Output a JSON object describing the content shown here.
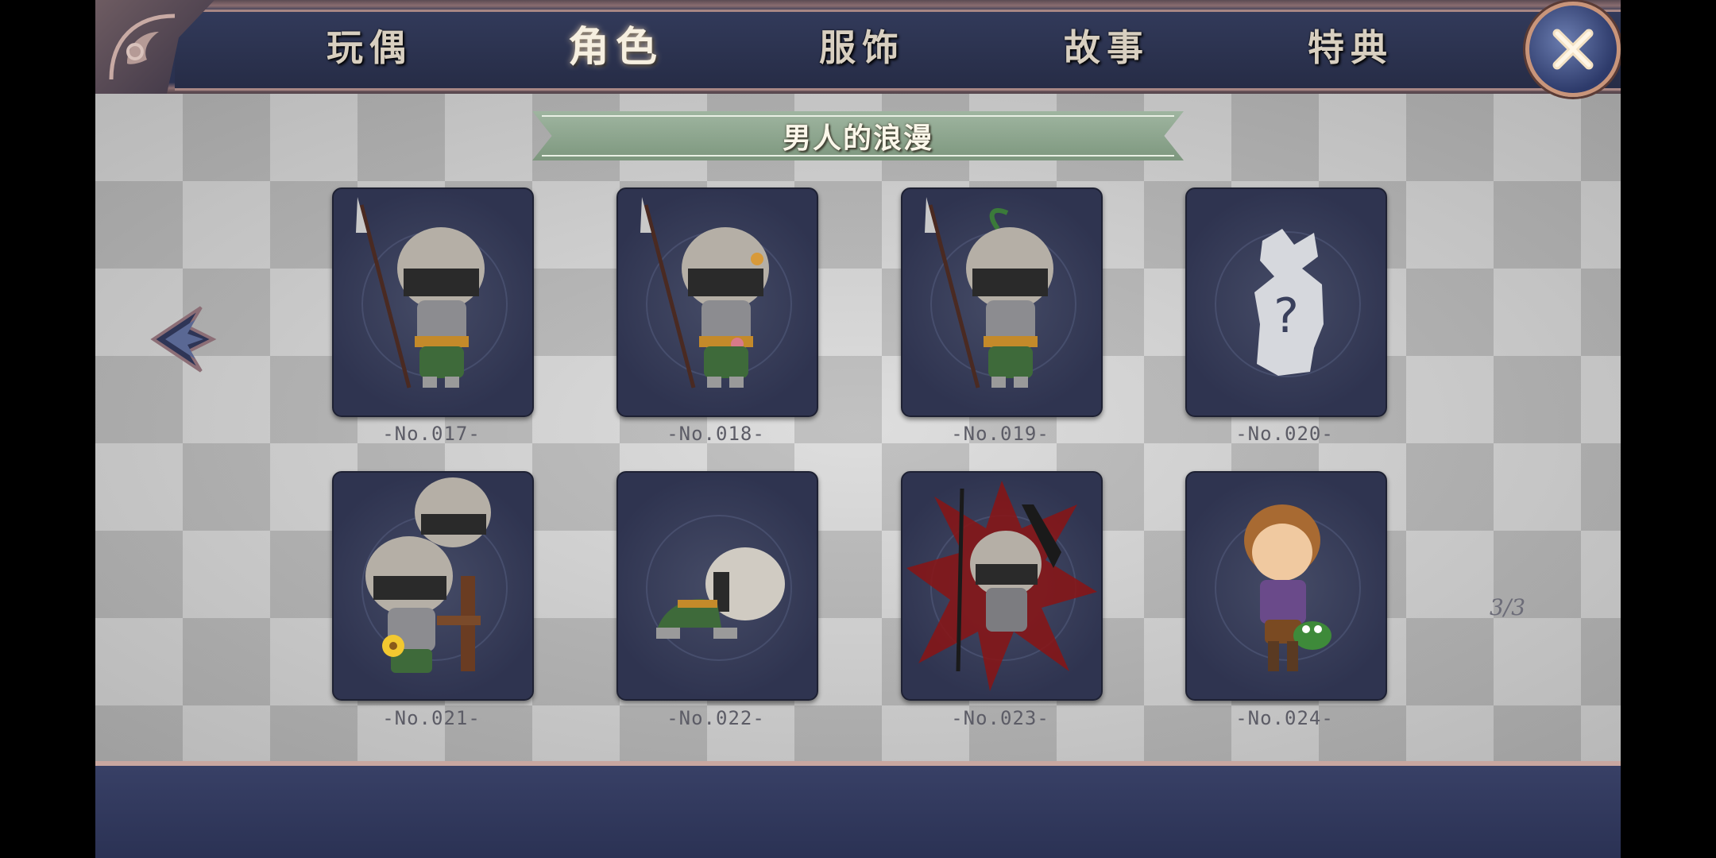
{
  "tabs": [
    {
      "label": "玩偶"
    },
    {
      "label": "角色"
    },
    {
      "label": "服饰"
    },
    {
      "label": "故事"
    },
    {
      "label": "特典"
    }
  ],
  "active_tab": "角色",
  "section_title": "男人的浪漫",
  "cards": [
    {
      "label": "-No.017-",
      "image": "soldier-with-spear"
    },
    {
      "label": "-No.018-",
      "image": "soldier-with-spear-and-flower"
    },
    {
      "label": "-No.019-",
      "image": "soldier-with-spear-and-sprout"
    },
    {
      "label": "-No.020-",
      "image": "locked-unknown-silhouette"
    },
    {
      "label": "-No.021-",
      "image": "two-soldiers-with-chair-and-flower"
    },
    {
      "label": "-No.022-",
      "image": "soldier-kneeling"
    },
    {
      "label": "-No.023-",
      "image": "soldier-red-shatter"
    },
    {
      "label": "-No.024-",
      "image": "brown-haired-boy-with-frog"
    }
  ],
  "page_indicator": "3/3",
  "colors": {
    "tab_bar": "#2a3150",
    "accent_border": "#c9957a",
    "banner": "#8fa890",
    "card_bg": "#3a405c"
  }
}
